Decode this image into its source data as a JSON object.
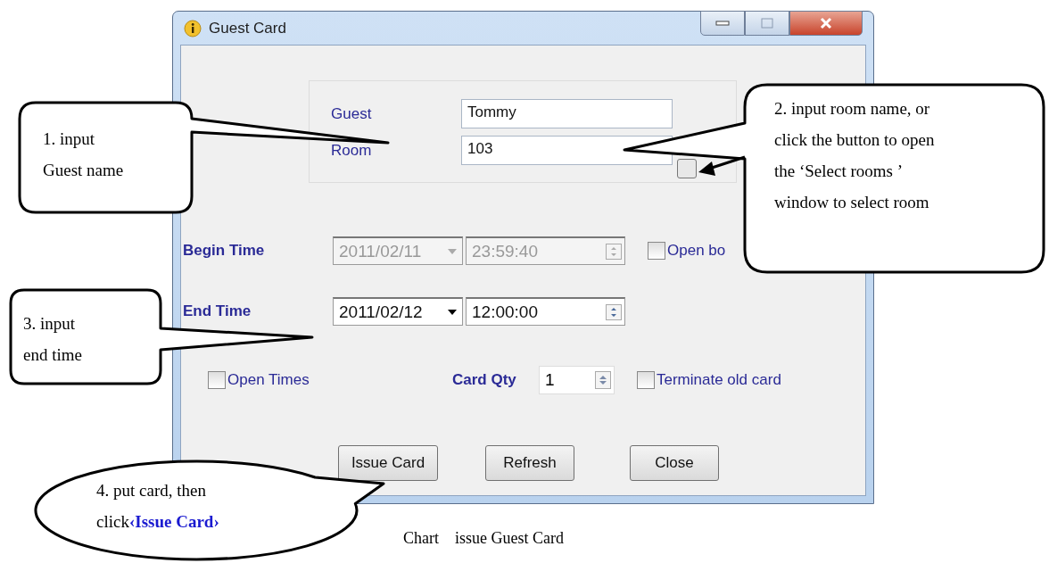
{
  "window": {
    "title": "Guest Card"
  },
  "room_group": {
    "fields": [
      {
        "label": "Guest",
        "value": "Tommy",
        "browse": false
      },
      {
        "label": "Room",
        "value": "103",
        "browse": true
      }
    ]
  },
  "time_rows": [
    {
      "label": "Begin Time",
      "date": "2011/02/11",
      "time": "23:59:40",
      "disabled": true,
      "option": {
        "label": "Open bo",
        "checked": false
      }
    },
    {
      "label": "End Time",
      "date": "2011/02/12",
      "time": "12:00:00",
      "disabled": false
    }
  ],
  "open_times": {
    "label": "Open Times",
    "checked": false
  },
  "card_qty": {
    "label": "Card Qty",
    "value": "1"
  },
  "terminate": {
    "label": "Terminate old card",
    "checked": false
  },
  "buttons": [
    "Issue Card",
    "Refresh",
    "Close"
  ],
  "callouts": [
    {
      "kind": "rect",
      "text": "1. input\nGuest name"
    },
    {
      "kind": "rect",
      "text": "2. input room name, or\nclick the button to open\nthe ‘Select rooms ’\nwindow to select room"
    },
    {
      "kind": "rect",
      "text": "3. input\nend time"
    },
    {
      "kind": "ellipse",
      "text": "4. put card, then\nclick**‹Issue Card›**"
    }
  ],
  "caption": "Chart    issue Guest Card"
}
